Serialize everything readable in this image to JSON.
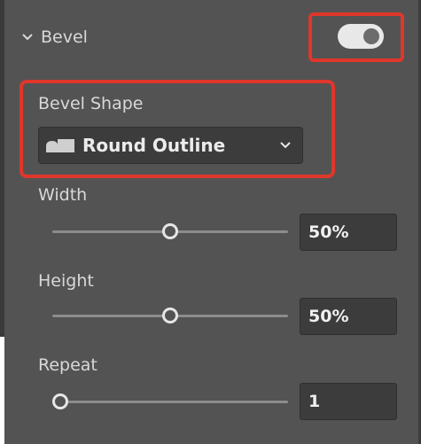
{
  "section": {
    "title": "Bevel",
    "enabled": true
  },
  "bevel_shape": {
    "label": "Bevel Shape",
    "value": "Round Outline",
    "icon": "round-outline-shape-icon"
  },
  "width": {
    "label": "Width",
    "value": "50%",
    "level": 0.5
  },
  "height": {
    "label": "Height",
    "value": "50%",
    "level": 0.5
  },
  "repeat": {
    "label": "Repeat",
    "value": "1",
    "level": 0
  },
  "colors": {
    "highlight": "#e0372b",
    "panel": "#535353",
    "field": "#3c3c3c"
  }
}
